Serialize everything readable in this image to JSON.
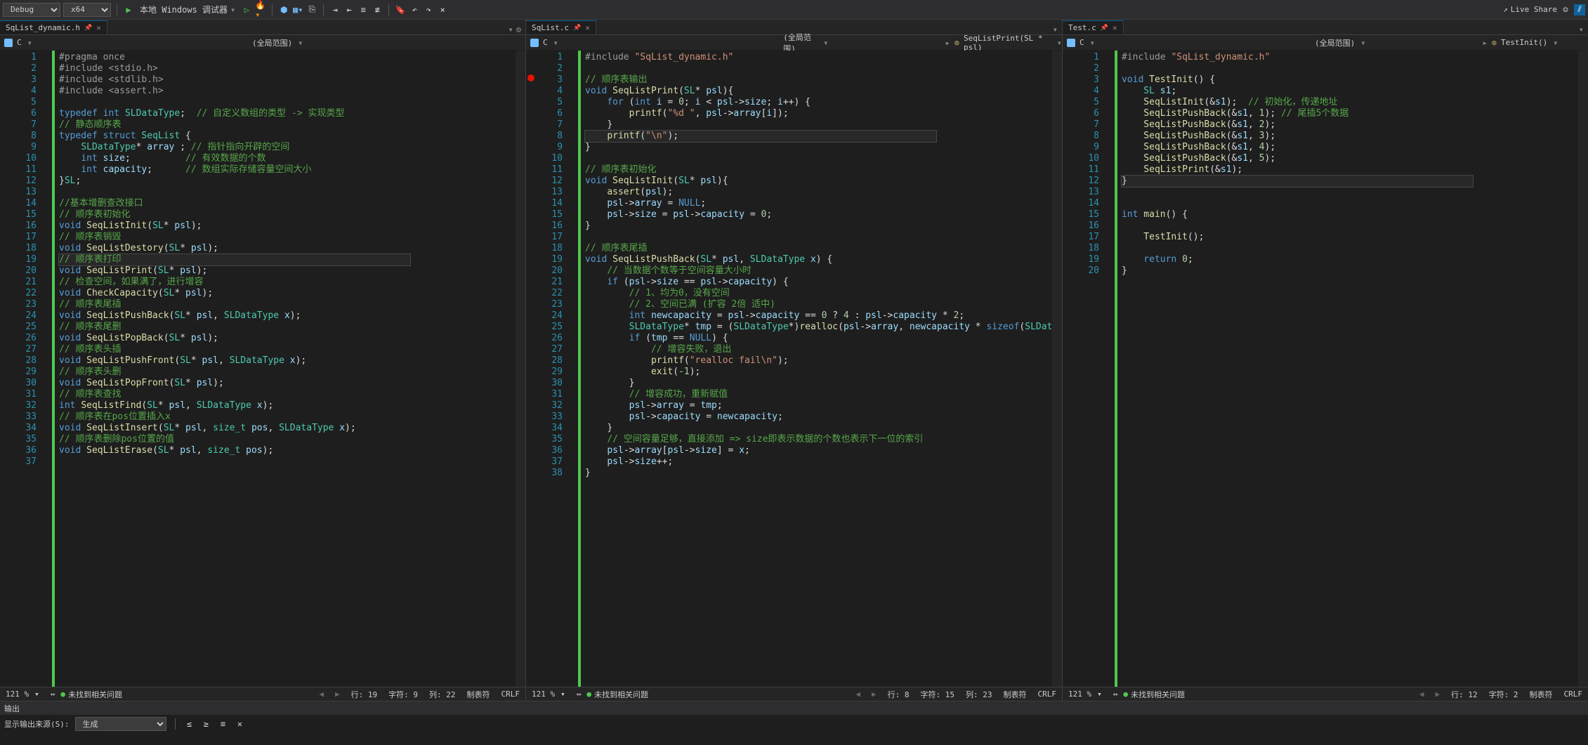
{
  "toolbar": {
    "config": "Debug",
    "platform": "x64",
    "debugger": "本地 Windows 调试器",
    "liveShare": "Live Share"
  },
  "panes": [
    {
      "tabs": [
        {
          "name": "SqList_dynamic.h",
          "pinned": true
        }
      ],
      "breadcrumbLang": "C",
      "breadcrumbScope": "(全局范围)",
      "statusZoom": "121 %",
      "statusIssues": "未找到相关问题",
      "statusLine": "行: 19",
      "statusChar": "字符: 9",
      "statusCol": "列: 22",
      "statusTab": "制表符",
      "statusEnc": "CRLF",
      "lines": [
        {
          "n": 1,
          "html": "<span class='m'>#pragma once</span>"
        },
        {
          "n": 2,
          "html": "<span class='m'>#include &lt;stdio.h&gt;</span>"
        },
        {
          "n": 3,
          "html": "<span class='m'>#include &lt;stdlib.h&gt;</span>"
        },
        {
          "n": 4,
          "html": "<span class='m'>#include &lt;assert.h&gt;</span>"
        },
        {
          "n": 5,
          "html": ""
        },
        {
          "n": 6,
          "html": "<span class='k'>typedef</span> <span class='k'>int</span> <span class='t'>SLDataType</span>;  <span class='c'>// 自定义数组的类型 -&gt; 实现类型</span>"
        },
        {
          "n": 7,
          "html": "<span class='c'>// 静态顺序表</span>"
        },
        {
          "n": 8,
          "html": "<span class='k'>typedef</span> <span class='k'>struct</span> <span class='t'>SeqList</span> {"
        },
        {
          "n": 9,
          "html": "    <span class='t'>SLDataType</span>* <span class='v'>array</span> ; <span class='c'>// 指针指向开辟的空间</span>"
        },
        {
          "n": 10,
          "html": "    <span class='k'>int</span> <span class='v'>size</span>;          <span class='c'>// 有效数据的个数</span>"
        },
        {
          "n": 11,
          "html": "    <span class='k'>int</span> <span class='v'>capacity</span>;      <span class='c'>// 数组实际存储容量空间大小</span>"
        },
        {
          "n": 12,
          "html": "}<span class='t'>SL</span>;"
        },
        {
          "n": 13,
          "html": ""
        },
        {
          "n": 14,
          "html": "<span class='c'>//基本增删查改接口</span>"
        },
        {
          "n": 15,
          "html": "<span class='c'>// 顺序表初始化</span>"
        },
        {
          "n": 16,
          "html": "<span class='k'>void</span> <span class='fn'>SeqListInit</span>(<span class='t'>SL</span>* <span class='v'>psl</span>);"
        },
        {
          "n": 17,
          "html": "<span class='c'>// 顺序表销毁</span>"
        },
        {
          "n": 18,
          "html": "<span class='k'>void</span> <span class='fn'>SeqListDestory</span>(<span class='t'>SL</span>* <span class='v'>psl</span>);"
        },
        {
          "n": 19,
          "html": "<span class='sel-line'><span class='c'>// 顺序表打印</span></span>"
        },
        {
          "n": 20,
          "html": "<span class='k'>void</span> <span class='fn'>SeqListPrint</span>(<span class='t'>SL</span>* <span class='v'>psl</span>);"
        },
        {
          "n": 21,
          "html": "<span class='c'>// 检查空间，如果满了，进行增容</span>"
        },
        {
          "n": 22,
          "html": "<span class='k'>void</span> <span class='fn'>CheckCapacity</span>(<span class='t'>SL</span>* <span class='v'>psl</span>);"
        },
        {
          "n": 23,
          "html": "<span class='c'>// 顺序表尾插</span>"
        },
        {
          "n": 24,
          "html": "<span class='k'>void</span> <span class='fn'>SeqListPushBack</span>(<span class='t'>SL</span>* <span class='v'>psl</span>, <span class='t'>SLDataType</span> <span class='v'>x</span>);"
        },
        {
          "n": 25,
          "html": "<span class='c'>// 顺序表尾删</span>"
        },
        {
          "n": 26,
          "html": "<span class='k'>void</span> <span class='fn'>SeqListPopBack</span>(<span class='t'>SL</span>* <span class='v'>psl</span>);"
        },
        {
          "n": 27,
          "html": "<span class='c'>// 顺序表头插</span>"
        },
        {
          "n": 28,
          "html": "<span class='k'>void</span> <span class='fn'>SeqListPushFront</span>(<span class='t'>SL</span>* <span class='v'>psl</span>, <span class='t'>SLDataType</span> <span class='v'>x</span>);"
        },
        {
          "n": 29,
          "html": "<span class='c'>// 顺序表头删</span>"
        },
        {
          "n": 30,
          "html": "<span class='k'>void</span> <span class='fn'>SeqListPopFront</span>(<span class='t'>SL</span>* <span class='v'>psl</span>);"
        },
        {
          "n": 31,
          "html": "<span class='c'>// 顺序表查找</span>"
        },
        {
          "n": 32,
          "html": "<span class='k'>int</span> <span class='fn'>SeqListFind</span>(<span class='t'>SL</span>* <span class='v'>psl</span>, <span class='t'>SLDataType</span> <span class='v'>x</span>);"
        },
        {
          "n": 33,
          "html": "<span class='c'>// 顺序表在pos位置插入x</span>"
        },
        {
          "n": 34,
          "html": "<span class='k'>void</span> <span class='fn'>SeqListInsert</span>(<span class='t'>SL</span>* <span class='v'>psl</span>, <span class='t'>size_t</span> <span class='v'>pos</span>, <span class='t'>SLDataType</span> <span class='v'>x</span>);"
        },
        {
          "n": 35,
          "html": "<span class='c'>// 顺序表删除pos位置的值</span>"
        },
        {
          "n": 36,
          "html": "<span class='k'>void</span> <span class='fn'>SeqListErase</span>(<span class='t'>SL</span>* <span class='v'>psl</span>, <span class='t'>size_t</span> <span class='v'>pos</span>);"
        },
        {
          "n": 37,
          "html": ""
        }
      ]
    },
    {
      "tabs": [
        {
          "name": "SqList.c",
          "pinned": true
        }
      ],
      "breadcrumbLang": "C",
      "breadcrumbScope": "(全局范围)",
      "breadcrumbFunc": "SeqListPrint(SL * psl)",
      "statusZoom": "121 %",
      "statusIssues": "未找到相关问题",
      "statusLine": "行: 8",
      "statusChar": "字符: 15",
      "statusCol": "列: 23",
      "statusTab": "制表符",
      "statusEnc": "CRLF",
      "breakpoint": 3,
      "lines": [
        {
          "n": 1,
          "html": "<span class='m'>#include </span><span class='s'>\"SqList_dynamic.h\"</span>"
        },
        {
          "n": 2,
          "html": ""
        },
        {
          "n": 3,
          "html": "<span class='c'>// 顺序表输出</span>"
        },
        {
          "n": 4,
          "html": "<span class='k'>void</span> <span class='fn'>SeqListPrint</span>(<span class='t'>SL</span>* <span class='v'>psl</span>){"
        },
        {
          "n": 5,
          "html": "    <span class='k'>for</span> (<span class='k'>int</span> <span class='v'>i</span> = <span class='n'>0</span>; <span class='v'>i</span> &lt; <span class='v'>psl</span>-&gt;<span class='v'>size</span>; <span class='v'>i</span>++) {"
        },
        {
          "n": 6,
          "html": "        <span class='fn'>printf</span>(<span class='s'>\"%d \"</span>, <span class='v'>psl</span>-&gt;<span class='v'>array</span>[<span class='v'>i</span>]);"
        },
        {
          "n": 7,
          "html": "    }"
        },
        {
          "n": 8,
          "html": "<span class='sel-line'>    <span class='fn'>printf</span>(<span class='s'>\"\\n\"</span>);</span>"
        },
        {
          "n": 9,
          "html": "}"
        },
        {
          "n": 10,
          "html": ""
        },
        {
          "n": 11,
          "html": "<span class='c'>// 顺序表初始化</span>"
        },
        {
          "n": 12,
          "html": "<span class='k'>void</span> <span class='fn'>SeqListInit</span>(<span class='t'>SL</span>* <span class='v'>psl</span>){"
        },
        {
          "n": 13,
          "html": "    <span class='fn'>assert</span>(<span class='v'>psl</span>);"
        },
        {
          "n": 14,
          "html": "    <span class='v'>psl</span>-&gt;<span class='v'>array</span> = <span class='k'>NULL</span>;"
        },
        {
          "n": 15,
          "html": "    <span class='v'>psl</span>-&gt;<span class='v'>size</span> = <span class='v'>psl</span>-&gt;<span class='v'>capacity</span> = <span class='n'>0</span>;"
        },
        {
          "n": 16,
          "html": "}"
        },
        {
          "n": 17,
          "html": ""
        },
        {
          "n": 18,
          "html": "<span class='c'>// 顺序表尾插</span>"
        },
        {
          "n": 19,
          "html": "<span class='k'>void</span> <span class='fn'>SeqListPushBack</span>(<span class='t'>SL</span>* <span class='v'>psl</span>, <span class='t'>SLDataType</span> <span class='v'>x</span>) {"
        },
        {
          "n": 20,
          "html": "    <span class='c'>// 当数据个数等于空间容量大小时</span>"
        },
        {
          "n": 21,
          "html": "    <span class='k'>if</span> (<span class='v'>psl</span>-&gt;<span class='v'>size</span> == <span class='v'>psl</span>-&gt;<span class='v'>capacity</span>) {"
        },
        {
          "n": 22,
          "html": "        <span class='c'>// 1、均为0，没有空间</span>"
        },
        {
          "n": 23,
          "html": "        <span class='c'>// 2、空间已满 (扩容 2倍 适中)</span>"
        },
        {
          "n": 24,
          "html": "        <span class='k'>int</span> <span class='v'>newcapacity</span> = <span class='v'>psl</span>-&gt;<span class='v'>capacity</span> == <span class='n'>0</span> ? <span class='n'>4</span> : <span class='v'>psl</span>-&gt;<span class='v'>capacity</span> * <span class='n'>2</span>;"
        },
        {
          "n": 25,
          "html": "        <span class='t'>SLDataType</span>* <span class='v'>tmp</span> = (<span class='t'>SLDataType</span>*)<span class='fn'>realloc</span>(<span class='v'>psl</span>-&gt;<span class='v'>array</span>, <span class='v'>newcapacity</span> * <span class='k'>sizeof</span>(<span class='t'>SLDataType</span>));"
        },
        {
          "n": 26,
          "html": "        <span class='k'>if</span> (<span class='v'>tmp</span> == <span class='k'>NULL</span>) {"
        },
        {
          "n": 27,
          "html": "            <span class='c'>// 增容失败，退出</span>"
        },
        {
          "n": 28,
          "html": "            <span class='fn'>printf</span>(<span class='s'>\"realloc fail\\n\"</span>);"
        },
        {
          "n": 29,
          "html": "            <span class='fn'>exit</span>(<span class='n'>-1</span>);"
        },
        {
          "n": 30,
          "html": "        }"
        },
        {
          "n": 31,
          "html": "        <span class='c'>// 增容成功，重新赋值</span>"
        },
        {
          "n": 32,
          "html": "        <span class='v'>psl</span>-&gt;<span class='v'>array</span> = <span class='v'>tmp</span>;"
        },
        {
          "n": 33,
          "html": "        <span class='v'>psl</span>-&gt;<span class='v'>capacity</span> = <span class='v'>newcapacity</span>;"
        },
        {
          "n": 34,
          "html": "    }"
        },
        {
          "n": 35,
          "html": "    <span class='c'>// 空间容量足够，直接添加 =&gt; size即表示数据的个数也表示下一位的索引</span>"
        },
        {
          "n": 36,
          "html": "    <span class='v'>psl</span>-&gt;<span class='v'>array</span>[<span class='v'>psl</span>-&gt;<span class='v'>size</span>] = <span class='v'>x</span>;"
        },
        {
          "n": 37,
          "html": "    <span class='v'>psl</span>-&gt;<span class='v'>size</span>++;"
        },
        {
          "n": 38,
          "html": "}"
        }
      ]
    },
    {
      "tabs": [
        {
          "name": "Test.c",
          "pinned": true
        }
      ],
      "breadcrumbLang": "C",
      "breadcrumbScope": "(全局范围)",
      "breadcrumbFunc": "TestInit()",
      "statusZoom": "121 %",
      "statusIssues": "未找到相关问题",
      "statusLine": "行: 12",
      "statusChar": "字符: 2",
      "statusCol": "",
      "statusTab": "制表符",
      "statusEnc": "CRLF",
      "lines": [
        {
          "n": 1,
          "html": "<span class='m'>#include </span><span class='s'>\"SqList_dynamic.h\"</span>"
        },
        {
          "n": 2,
          "html": ""
        },
        {
          "n": 3,
          "html": "<span class='k'>void</span> <span class='fn'>TestInit</span>() {"
        },
        {
          "n": 4,
          "html": "    <span class='t'>SL</span> <span class='v'>s1</span>;"
        },
        {
          "n": 5,
          "html": "    <span class='fn'>SeqListInit</span>(&amp;<span class='v'>s1</span>);  <span class='c'>// 初始化，传递地址</span>"
        },
        {
          "n": 6,
          "html": "    <span class='fn'>SeqListPushBack</span>(&amp;<span class='v'>s1</span>, <span class='n'>1</span>); <span class='c'>// 尾插5个数据</span>"
        },
        {
          "n": 7,
          "html": "    <span class='fn'>SeqListPushBack</span>(&amp;<span class='v'>s1</span>, <span class='n'>2</span>);"
        },
        {
          "n": 8,
          "html": "    <span class='fn'>SeqListPushBack</span>(&amp;<span class='v'>s1</span>, <span class='n'>3</span>);"
        },
        {
          "n": 9,
          "html": "    <span class='fn'>SeqListPushBack</span>(&amp;<span class='v'>s1</span>, <span class='n'>4</span>);"
        },
        {
          "n": 10,
          "html": "    <span class='fn'>SeqListPushBack</span>(&amp;<span class='v'>s1</span>, <span class='n'>5</span>);"
        },
        {
          "n": 11,
          "html": "    <span class='fn'>SeqListPrint</span>(&amp;<span class='v'>s1</span>);"
        },
        {
          "n": 12,
          "html": "<span class='sel-line'>}</span>"
        },
        {
          "n": 13,
          "html": ""
        },
        {
          "n": 14,
          "html": ""
        },
        {
          "n": 15,
          "html": "<span class='k'>int</span> <span class='fn'>main</span>() {"
        },
        {
          "n": 16,
          "html": ""
        },
        {
          "n": 17,
          "html": "    <span class='fn'>TestInit</span>();"
        },
        {
          "n": 18,
          "html": ""
        },
        {
          "n": 19,
          "html": "    <span class='k'>return</span> <span class='n'>0</span>;"
        },
        {
          "n": 20,
          "html": "}"
        }
      ]
    }
  ],
  "output": {
    "title": "输出",
    "sourceLabel": "显示输出来源(S):",
    "sourceValue": "生成"
  }
}
